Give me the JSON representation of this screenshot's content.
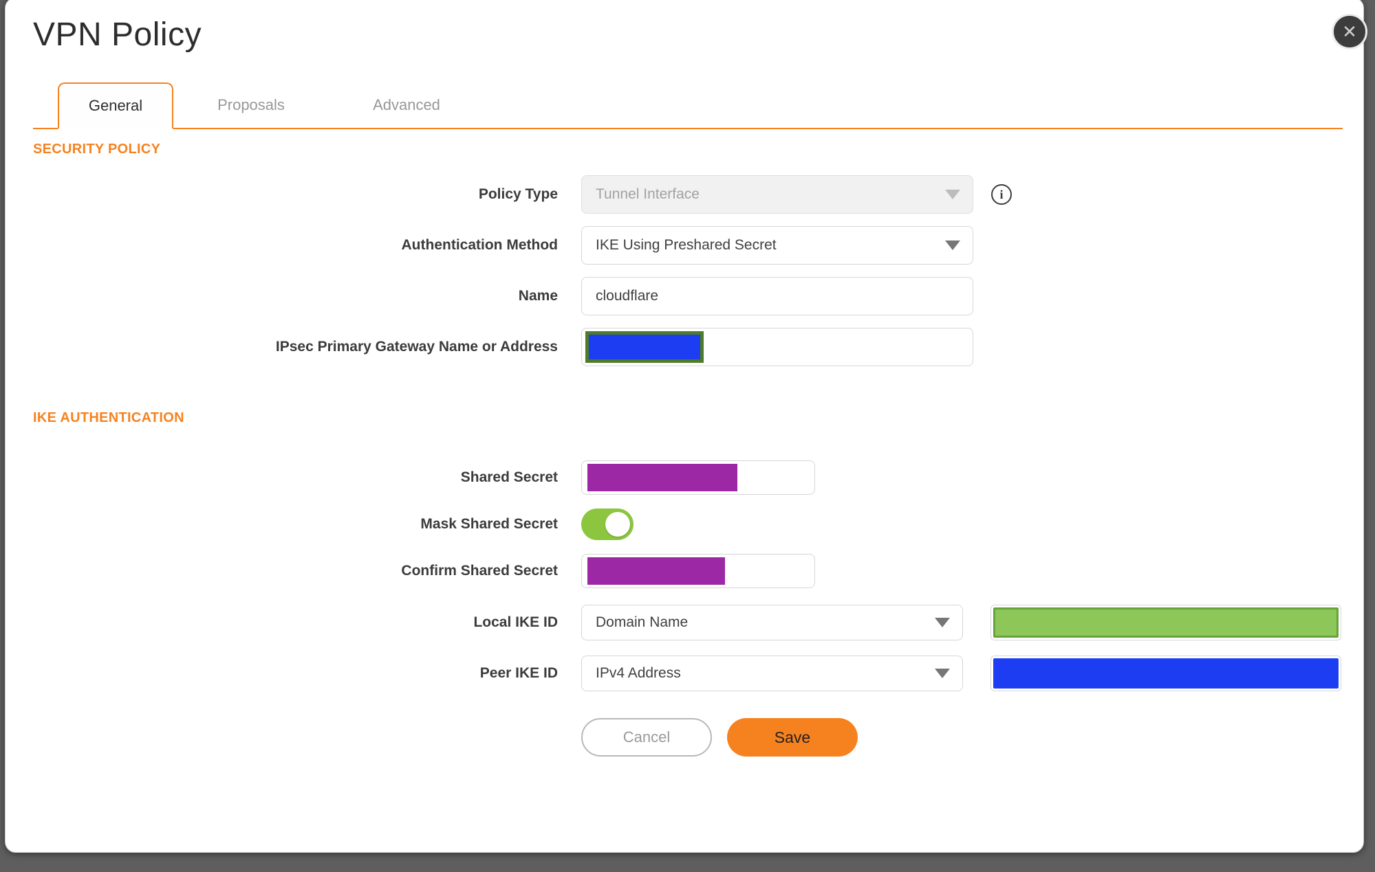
{
  "dialog": {
    "title": "VPN Policy"
  },
  "icons": {
    "close": "✕",
    "info": "i",
    "chevron_down": "▼"
  },
  "tabs": [
    {
      "label": "General",
      "active": true
    },
    {
      "label": "Proposals",
      "active": false
    },
    {
      "label": "Advanced",
      "active": false
    }
  ],
  "sections": {
    "security_policy": {
      "heading": "SECURITY POLICY",
      "fields": {
        "policy_type": {
          "label": "Policy Type",
          "value": "Tunnel Interface",
          "disabled": true
        },
        "auth_method": {
          "label": "Authentication Method",
          "value": "IKE Using Preshared Secret"
        },
        "name": {
          "label": "Name",
          "value": "cloudflare"
        },
        "gateway": {
          "label": "IPsec Primary Gateway Name or Address",
          "value": "",
          "masked": true
        }
      }
    },
    "ike_authentication": {
      "heading": "IKE AUTHENTICATION",
      "fields": {
        "shared_secret": {
          "label": "Shared Secret",
          "value": "",
          "masked": true
        },
        "mask_shared_secret": {
          "label": "Mask Shared Secret",
          "toggle_on": true
        },
        "confirm_shared_secret": {
          "label": "Confirm Shared Secret",
          "value": "",
          "masked": true
        },
        "local_ike_id": {
          "label": "Local IKE ID",
          "value": "Domain Name",
          "masked_value": true
        },
        "peer_ike_id": {
          "label": "Peer IKE ID",
          "value": "IPv4 Address",
          "masked_value": true
        }
      }
    }
  },
  "buttons": {
    "cancel": "Cancel",
    "save": "Save"
  },
  "colors": {
    "accent_orange": "#f6821f",
    "toggle_green": "#8cc63e",
    "mask_purple": "#9c28a6",
    "mask_blue": "#1d3df2",
    "mask_green_fill": "#8dc75a",
    "mask_green_border": "#65a33b",
    "mask_olive_border": "#4e7b26",
    "backdrop_gray": "#5e5e5e"
  }
}
